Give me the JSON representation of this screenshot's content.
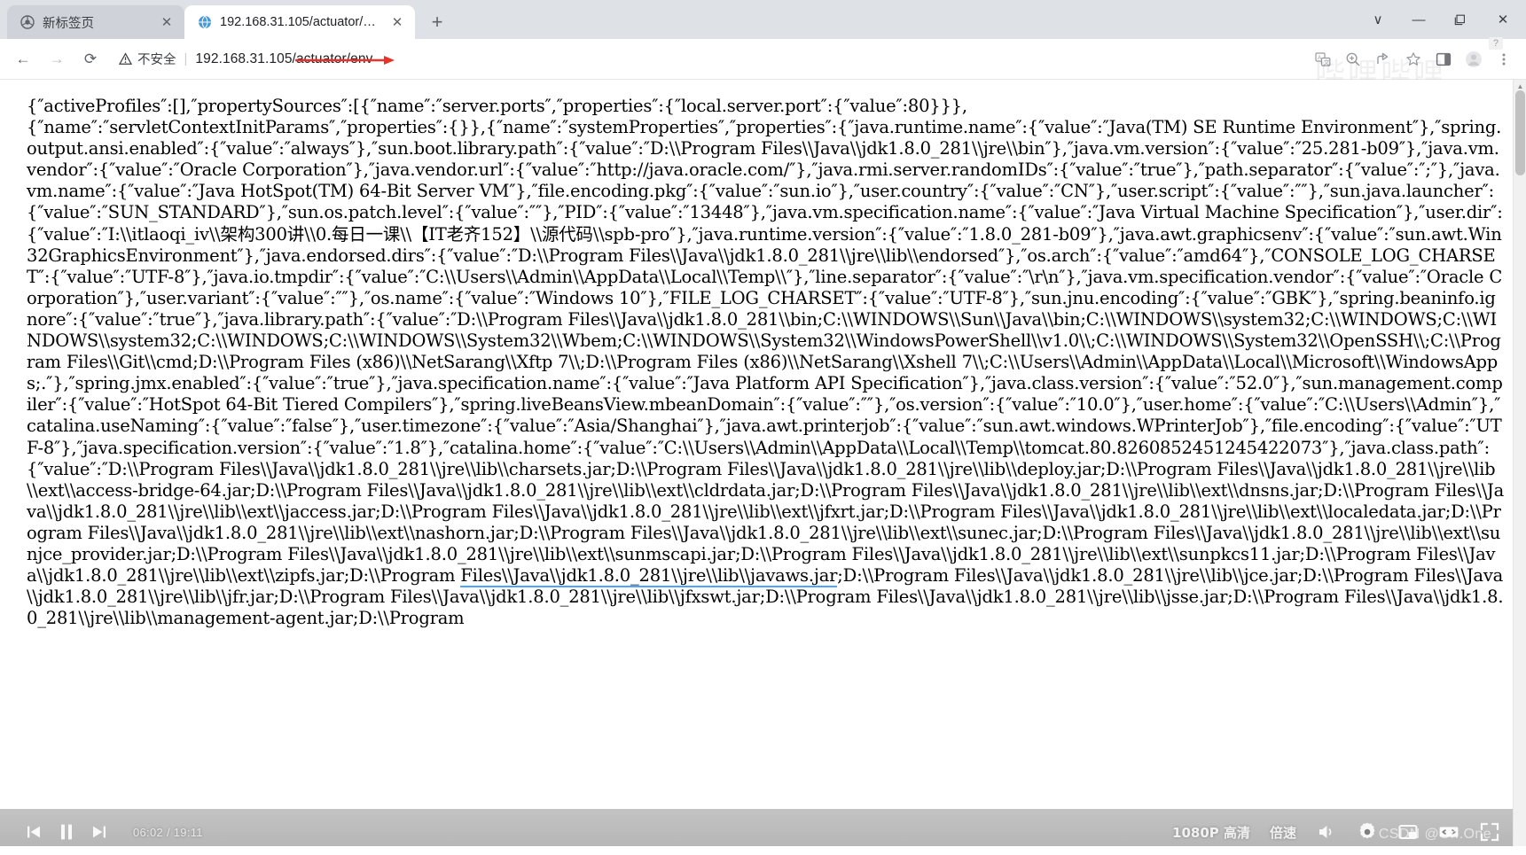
{
  "window": {
    "minimize_label": "—",
    "maximize_label": "❐",
    "close_label": "✕",
    "more_label": "∨"
  },
  "tabs": [
    {
      "title": "新标签页",
      "close_label": "✕",
      "active": false,
      "favicon": "chrome-icon"
    },
    {
      "title": "192.168.31.105/actuator/env",
      "close_label": "✕",
      "active": true,
      "favicon": "globe-icon"
    }
  ],
  "newtab": {
    "label": "+"
  },
  "toolbar": {
    "back_label": "←",
    "forward_label": "→",
    "reload_label": "⟳",
    "warning_icon_label": "⚠",
    "security_text": "不安全",
    "separator": "|",
    "url": "192.168.31.105/actuator/env",
    "qmark_badge": "?",
    "icons": [
      "translate-icon",
      "zoom-icon",
      "share-icon",
      "star-icon",
      "sidepanel-icon",
      "avatar-icon",
      "menu-kebab-icon"
    ]
  },
  "chrome_watermark": "哔哩哔哩",
  "page": {
    "scrollbar": {
      "up_arrow": "▲",
      "down_arrow": "▼"
    },
    "json_text": "{″activeProfiles″:[],″propertySources″:[{″name″:″server.ports″,″properties″:{″local.server.port″:{″value″:80}}},\n{″name″:″servletContextInitParams″,″properties″:{}},{″name″:″systemProperties″,″properties″:{″java.runtime.name″:{″value″:″Java(TM) SE Runtime Environment″},″spring.output.ansi.enabled″:{″value″:″always″},″sun.boot.library.path″:{″value″:″D:\\\\Program Files\\\\Java\\\\jdk1.8.0_281\\\\jre\\\\bin″},″java.vm.version″:{″value″:″25.281-b09″},″java.vm.vendor″:{″value″:″Oracle Corporation″},″java.vendor.url″:{″value″:″http://java.oracle.com/″},″java.rmi.server.randomIDs″:{″value″:″true″},″path.separator″:{″value″:″;″},″java.vm.name″:{″value″:″Java HotSpot(TM) 64-Bit Server VM″},″file.encoding.pkg″:{″value″:″sun.io″},″user.country″:{″value″:″CN″},″user.script″:{″value″:″″},″sun.java.launcher″:{″value″:″SUN_STANDARD″},″sun.os.patch.level″:{″value″:″″},″PID″:{″value″:″13448″},″java.vm.specification.name″:{″value″:″Java Virtual Machine Specification″},″user.dir″:{″value″:″I:\\\\itlaoqi_iv\\\\架构300讲\\\\0.每日一课\\\\【IT老齐152】\\\\源代码\\\\spb-pro″},″java.runtime.version″:{″value″:″1.8.0_281-b09″},″java.awt.graphicsenv″:{″value″:″sun.awt.Win32GraphicsEnvironment″},″java.endorsed.dirs″:{″value″:″D:\\\\Program Files\\\\Java\\\\jdk1.8.0_281\\\\jre\\\\lib\\\\endorsed″},″os.arch″:{″value″:″amd64″},″CONSOLE_LOG_CHARSET″:{″value″:″UTF-8″},″java.io.tmpdir″:{″value″:″C:\\\\Users\\\\Admin\\\\AppData\\\\Local\\\\Temp\\\\″},″line.separator″:{″value″:″\\r\\n″},″java.vm.specification.vendor″:{″value″:″Oracle Corporation″},″user.variant″:{″value″:″″},″os.name″:{″value″:″Windows 10″},″FILE_LOG_CHARSET″:{″value″:″UTF-8″},″sun.jnu.encoding″:{″value″:″GBK″},″spring.beaninfo.ignore″:{″value″:″true″},″java.library.path″:{″value″:″D:\\\\Program Files\\\\Java\\\\jdk1.8.0_281\\\\bin;C:\\\\WINDOWS\\\\Sun\\\\Java\\\\bin;C:\\\\WINDOWS\\\\system32;C:\\\\WINDOWS;C:\\\\WINDOWS\\\\system32;C:\\\\WINDOWS;C:\\\\WINDOWS\\\\System32\\\\Wbem;C:\\\\WINDOWS\\\\System32\\\\WindowsPowerShell\\\\v1.0\\\\;C:\\\\WINDOWS\\\\System32\\\\OpenSSH\\\\;C:\\\\Program Files\\\\Git\\\\cmd;D:\\\\Program Files (x86)\\\\NetSarang\\\\Xftp 7\\\\;D:\\\\Program Files (x86)\\\\NetSarang\\\\Xshell 7\\\\;C:\\\\Users\\\\Admin\\\\AppData\\\\Local\\\\Microsoft\\\\WindowsApps;.″},″spring.jmx.enabled″:{″value″:″true″},″java.specification.name″:{″value″:″Java Platform API Specification″},″java.class.version″:{″value″:″52.0″},″sun.management.compiler″:{″value″:″HotSpot 64-Bit Tiered Compilers″},″spring.liveBeansView.mbeanDomain″:{″value″:″″},″os.version″:{″value″:″10.0″},″user.home″:{″value″:″C:\\\\Users\\\\Admin″},″catalina.useNaming″:{″value″:″false″},″user.timezone″:{″value″:″Asia/Shanghai″},″java.awt.printerjob″:{″value″:″sun.awt.windows.WPrinterJob″},″file.encoding″:{″value″:″UTF-8″},″java.specification.version″:{″value″:″1.8″},″catalina.home″:{″value″:″C:\\\\Users\\\\Admin\\\\AppData\\\\Local\\\\Temp\\\\tomcat.80.8260852451245422073″},″java.class.path″:{″value″:″D:\\\\Program Files\\\\Java\\\\jdk1.8.0_281\\\\jre\\\\lib\\\\charsets.jar;D:\\\\Program Files\\\\Java\\\\jdk1.8.0_281\\\\jre\\\\lib\\\\deploy.jar;D:\\\\Program Files\\\\Java\\\\jdk1.8.0_281\\\\jre\\\\lib\\\\ext\\\\access-bridge-64.jar;D:\\\\Program Files\\\\Java\\\\jdk1.8.0_281\\\\jre\\\\lib\\\\ext\\\\cldrdata.jar;D:\\\\Program Files\\\\Java\\\\jdk1.8.0_281\\\\jre\\\\lib\\\\ext\\\\dnsns.jar;D:\\\\Program Files\\\\Java\\\\jdk1.8.0_281\\\\jre\\\\lib\\\\ext\\\\jaccess.jar;D:\\\\Program Files\\\\Java\\\\jdk1.8.0_281\\\\jre\\\\lib\\\\ext\\\\jfxrt.jar;D:\\\\Program Files\\\\Java\\\\jdk1.8.0_281\\\\jre\\\\lib\\\\ext\\\\localedata.jar;D:\\\\Program Files\\\\Java\\\\jdk1.8.0_281\\\\jre\\\\lib\\\\ext\\\\nashorn.jar;D:\\\\Program Files\\\\Java\\\\jdk1.8.0_281\\\\jre\\\\lib\\\\ext\\\\sunec.jar;D:\\\\Program Files\\\\Java\\\\jdk1.8.0_281\\\\jre\\\\lib\\\\ext\\\\sunjce_provider.jar;D:\\\\Program Files\\\\Java\\\\jdk1.8.0_281\\\\jre\\\\lib\\\\ext\\\\sunmscapi.jar;D:\\\\Program Files\\\\Java\\\\jdk1.8.0_281\\\\jre\\\\lib\\\\ext\\\\sunpkcs11.jar;D:\\\\Program Files\\\\Java\\\\jdk1.8.0_281\\\\jre\\\\lib\\\\ext\\\\zipfs.jar;D:\\\\Program ",
    "json_text_highlighted": "Files\\\\Java\\\\jdk1.8.0_281\\\\jre\\\\lib\\\\javaws.jar",
    "json_text_tail": ";D:\\\\Program Files\\\\Java\\\\jdk1.8.0_281\\\\jre\\\\lib\\\\jce.jar;D:\\\\Program Files\\\\Java\\\\jdk1.8.0_281\\\\jre\\\\lib\\\\jfr.jar;D:\\\\Program Files\\\\Java\\\\jdk1.8.0_281\\\\jre\\\\lib\\\\jfxswt.jar;D:\\\\Program Files\\\\Java\\\\jdk1.8.0_281\\\\jre\\\\lib\\\\jsse.jar;D:\\\\Program Files\\\\Java\\\\jdk1.8.0_281\\\\jre\\\\lib\\\\management-agent.jar;D:\\\\Program "
  },
  "video_player": {
    "prev_label": "prev-track-icon",
    "pause_label": "pause-icon",
    "next_label": "next-track-icon",
    "time": "06:02 / 19:11",
    "quality": "1080P 高清",
    "speed": "倍速",
    "volume_label": "volume-icon",
    "settings_label": "settings-gear-icon",
    "pip_label": "picture-in-picture-icon",
    "widescreen_label": "widescreen-icon",
    "fullscreen_label": "fullscreen-icon",
    "watermark": "CSDN @Or..One"
  }
}
